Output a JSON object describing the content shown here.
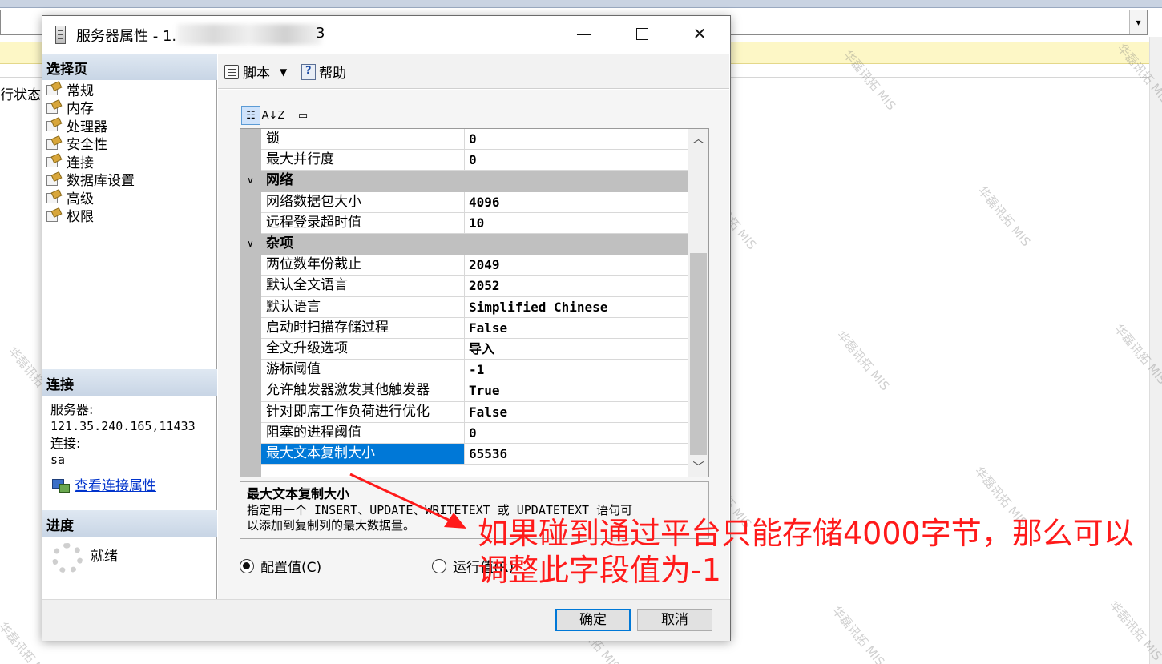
{
  "background": {
    "status_text": "行状态",
    "combo_arrow": "▾"
  },
  "dialog": {
    "title": "服务器属性 - 1.",
    "title_suffix": "3",
    "window_controls": {
      "minimize": "—",
      "close": "✕"
    }
  },
  "left_pane": {
    "select_page_header": "选择页",
    "nav_items": [
      "常规",
      "内存",
      "处理器",
      "安全性",
      "连接",
      "数据库设置",
      "高级",
      "权限"
    ],
    "connection_header": "连接",
    "server_label": "服务器:",
    "server_value": "121.35.240.165,11433",
    "connection_label": "连接:",
    "connection_value": "sa",
    "view_connection_link": "查看连接属性",
    "progress_header": "进度",
    "progress_status": "就绪"
  },
  "toolbar": {
    "script_label": "脚本",
    "help_label": "帮助",
    "sort_categorized": "☷",
    "sort_alpha": "A↓Z"
  },
  "property_grid": {
    "rows": [
      {
        "type": "prop",
        "name": "锁",
        "value": "0"
      },
      {
        "type": "prop",
        "name": "最大并行度",
        "value": "0"
      },
      {
        "type": "cat",
        "name": "网络"
      },
      {
        "type": "prop",
        "name": "网络数据包大小",
        "value": "4096"
      },
      {
        "type": "prop",
        "name": "远程登录超时值",
        "value": "10"
      },
      {
        "type": "cat",
        "name": "杂项"
      },
      {
        "type": "prop",
        "name": "两位数年份截止",
        "value": "2049"
      },
      {
        "type": "prop",
        "name": "默认全文语言",
        "value": "2052"
      },
      {
        "type": "prop",
        "name": "默认语言",
        "value": "Simplified Chinese"
      },
      {
        "type": "prop",
        "name": "启动时扫描存储过程",
        "value": "False"
      },
      {
        "type": "prop",
        "name": "全文升级选项",
        "value": "导入"
      },
      {
        "type": "prop",
        "name": "游标阈值",
        "value": "-1"
      },
      {
        "type": "prop",
        "name": "允许触发器激发其他触发器",
        "value": "True"
      },
      {
        "type": "prop",
        "name": "针对即席工作负荷进行优化",
        "value": "False"
      },
      {
        "type": "prop",
        "name": "阻塞的进程阈值",
        "value": "0"
      },
      {
        "type": "prop",
        "name": "最大文本复制大小",
        "value": "65536",
        "selected": true
      }
    ]
  },
  "description": {
    "title": "最大文本复制大小",
    "text_line1": "指定用一个 INSERT、UPDATE、WRITETEXT 或 UPDATETEXT 语句可",
    "text_line2": "以添加到复制列的最大数据量。"
  },
  "options": {
    "configured_value": "配置值(C)",
    "running_value": "运行值(R)"
  },
  "buttons": {
    "ok": "确定",
    "cancel": "取消"
  },
  "annotation": {
    "text": "如果碰到通过平台只能存储4000字节，那么可以调整此字段值为-1",
    "color": "#ff1a1a"
  },
  "watermark": {
    "text": "华磊讯拓 MIS"
  }
}
